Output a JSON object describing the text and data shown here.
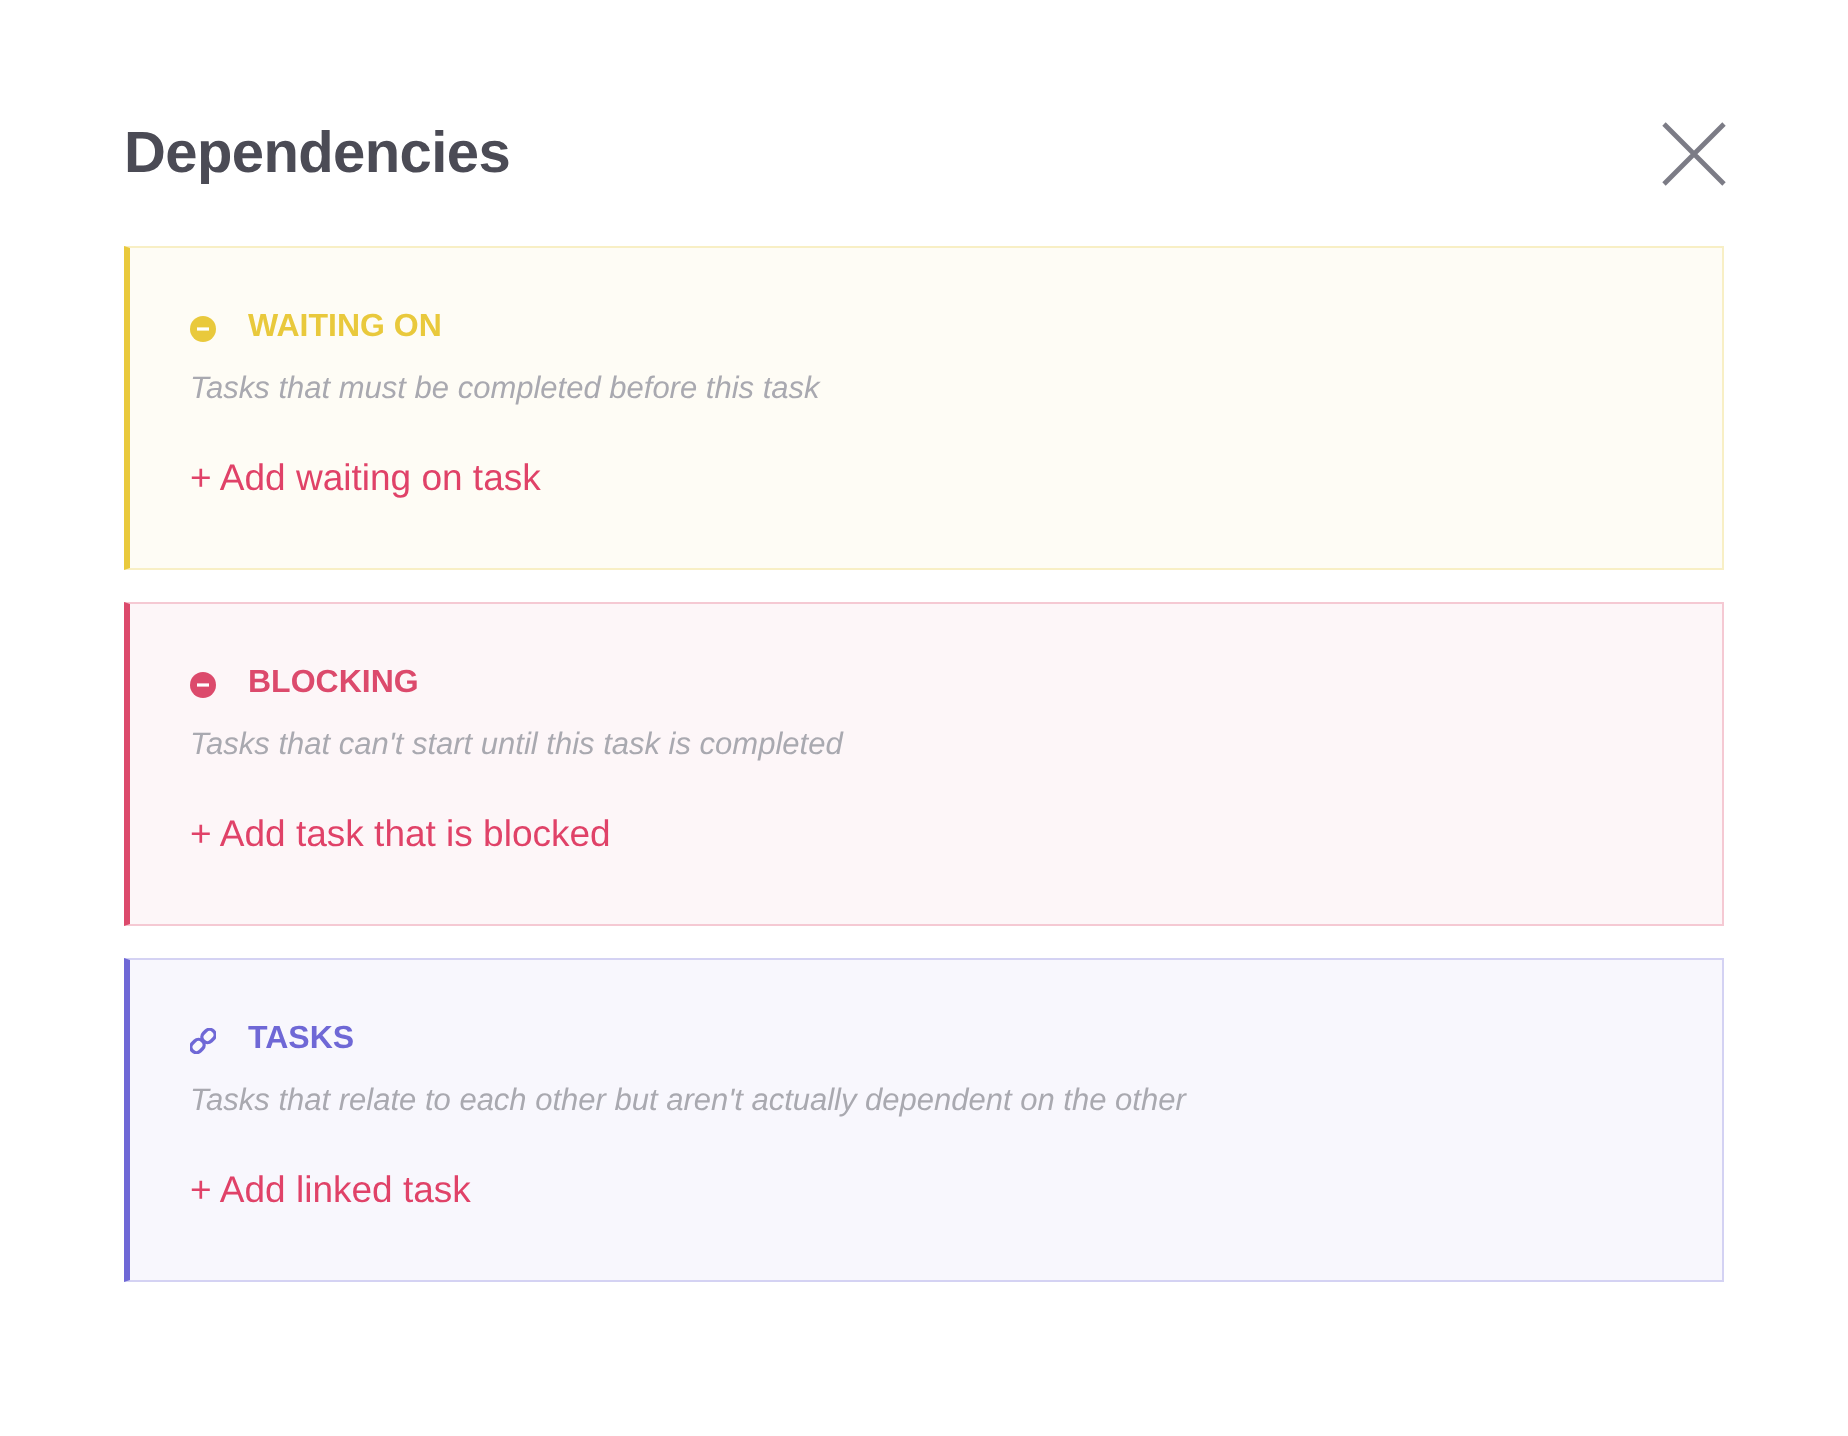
{
  "dialog": {
    "title": "Dependencies"
  },
  "sections": [
    {
      "kind": "minus",
      "color": "#e9c93c",
      "heading": "WAITING ON",
      "description": "Tasks that must be completed before this task",
      "action": "+ Add waiting on task"
    },
    {
      "kind": "minus",
      "color": "#dc4a6c",
      "heading": "BLOCKING",
      "description": "Tasks that can't start until this task is completed",
      "action": "+ Add task that is blocked"
    },
    {
      "kind": "link",
      "color": "#6f68d6",
      "heading": "TASKS",
      "description": "Tasks that relate to each other but aren't actually dependent on the other",
      "action": "+ Add linked task"
    }
  ]
}
